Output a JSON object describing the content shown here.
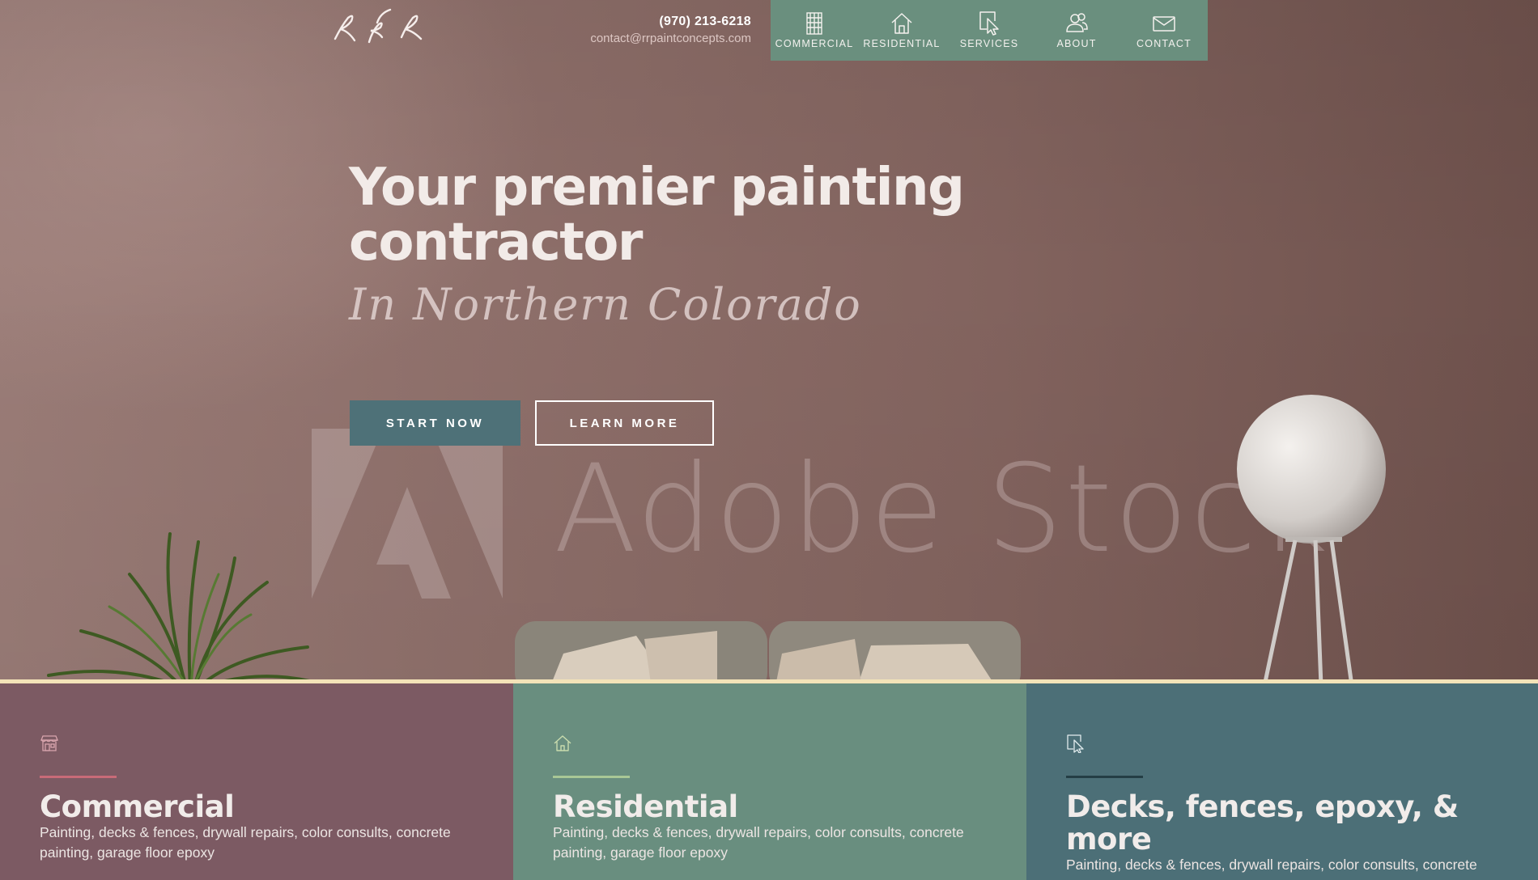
{
  "header": {
    "phone": "(970) 213-6218",
    "email": "contact@rrpaintconcepts.com",
    "logo_alt": "R&R"
  },
  "nav": {
    "items": [
      {
        "label": "COMMERCIAL",
        "icon": "building-icon"
      },
      {
        "label": "RESIDENTIAL",
        "icon": "house-icon"
      },
      {
        "label": "SERVICES",
        "icon": "cursor-click-icon"
      },
      {
        "label": "ABOUT",
        "icon": "users-icon"
      },
      {
        "label": "CONTACT",
        "icon": "envelope-icon"
      }
    ]
  },
  "hero": {
    "headline": "Your premier painting contractor",
    "script_line": "In Northern Colorado",
    "start_label": "START NOW",
    "learn_label": "LEARN MORE",
    "watermark": "Adobe Stock"
  },
  "cards": [
    {
      "title": "Commercial",
      "description": "Painting, decks & fences, drywall repairs, color consults, concrete painting, garage floor epoxy",
      "icon": "storefront-icon",
      "background": "#7c5a63",
      "accent": "#c86b78"
    },
    {
      "title": "Residential",
      "description": "Painting, decks & fences, drywall repairs, color consults, concrete painting, garage floor epoxy",
      "icon": "house-icon",
      "background": "#698e7f",
      "accent": "#a8c796"
    },
    {
      "title": "Decks, fences, epoxy, & more",
      "description": "Painting, decks & fences, drywall repairs, color consults, concrete",
      "icon": "cursor-click-icon",
      "background": "#4c6f77",
      "accent": "#243e45"
    }
  ],
  "colors": {
    "nav_bg": "#6a8f7e",
    "start_button": "#4e7178",
    "divider": "#f3e3b8"
  }
}
